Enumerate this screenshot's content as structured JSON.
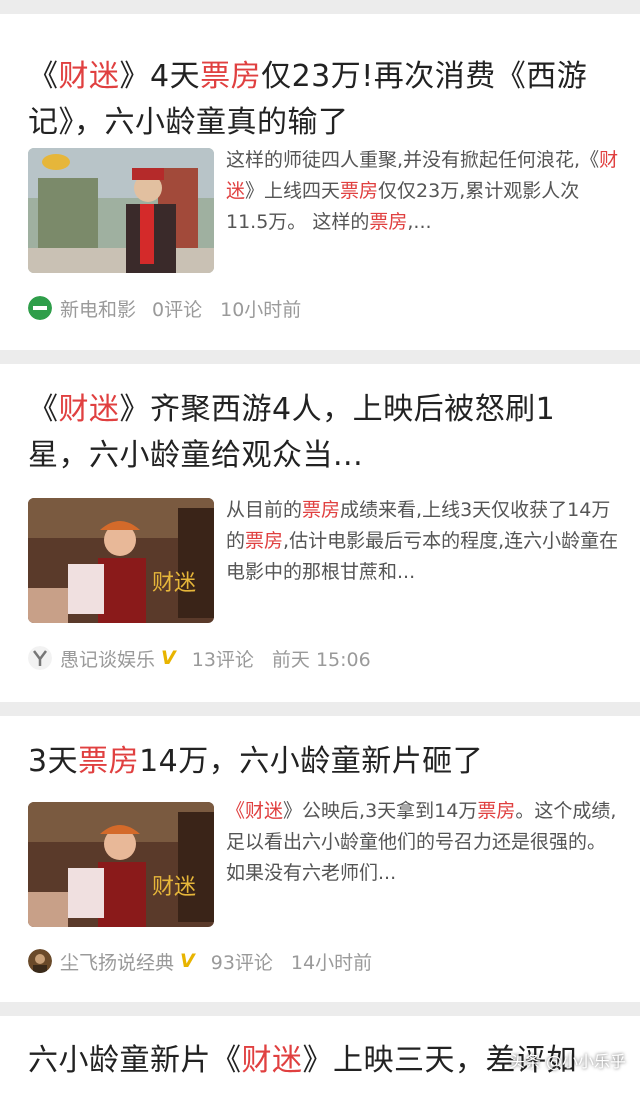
{
  "articles": [
    {
      "title_parts": [
        "《",
        "财迷",
        "》4天",
        "票房",
        "仅23万!再次消费《西游记》，六小龄童真的输了"
      ],
      "snippet_parts": [
        "这样的师徒四人重聚,并没有掀起任何浪花,《",
        "财迷",
        "》上线四天",
        "票房",
        "仅仅23万,累计观影人次11.5万。 这样的",
        "票房",
        ",..."
      ],
      "source": "新电和影",
      "comments": "0评论",
      "time": "10小时前",
      "verified": false,
      "avatar_icon": "green-circle-logo-icon"
    },
    {
      "title_parts": [
        "《",
        "财迷",
        "》齐聚西游4人，上映后被怒刷1星，六小龄童给观众当..."
      ],
      "snippet_parts": [
        "从目前的",
        "票房",
        "成绩来看,上线3天仅收获了14万的",
        "票房",
        ",估计电影最后亏本的程度,连六小龄童在电影中的那根甘蔗和..."
      ],
      "source": "愚记谈娱乐",
      "verified_mark": "V",
      "comments": "13评论",
      "time": "前天 15:06",
      "verified": true,
      "avatar_icon": "y-logo-icon"
    },
    {
      "title_parts": [
        "3天",
        "票房",
        "14万，六小龄童新片砸了"
      ],
      "snippet_parts": [
        "《",
        "财迷",
        "》公映后,3天拿到14万",
        "票房",
        "。这个成绩,足以看出六小龄童他们的号召力还是很强的。 如果没有六老师们..."
      ],
      "source": "尘飞扬说经典",
      "verified_mark": "V",
      "comments": "93评论",
      "time": "14小时前",
      "verified": true,
      "avatar_icon": "photo-avatar-icon"
    },
    {
      "title_parts": [
        "六小龄童新片《",
        "财迷",
        "》上映三天，差评如"
      ]
    }
  ],
  "watermark": "头条 @小小乐乎",
  "colors": {
    "highlight": "#e04040",
    "background": "#ececec",
    "verified": "#e8b400"
  }
}
